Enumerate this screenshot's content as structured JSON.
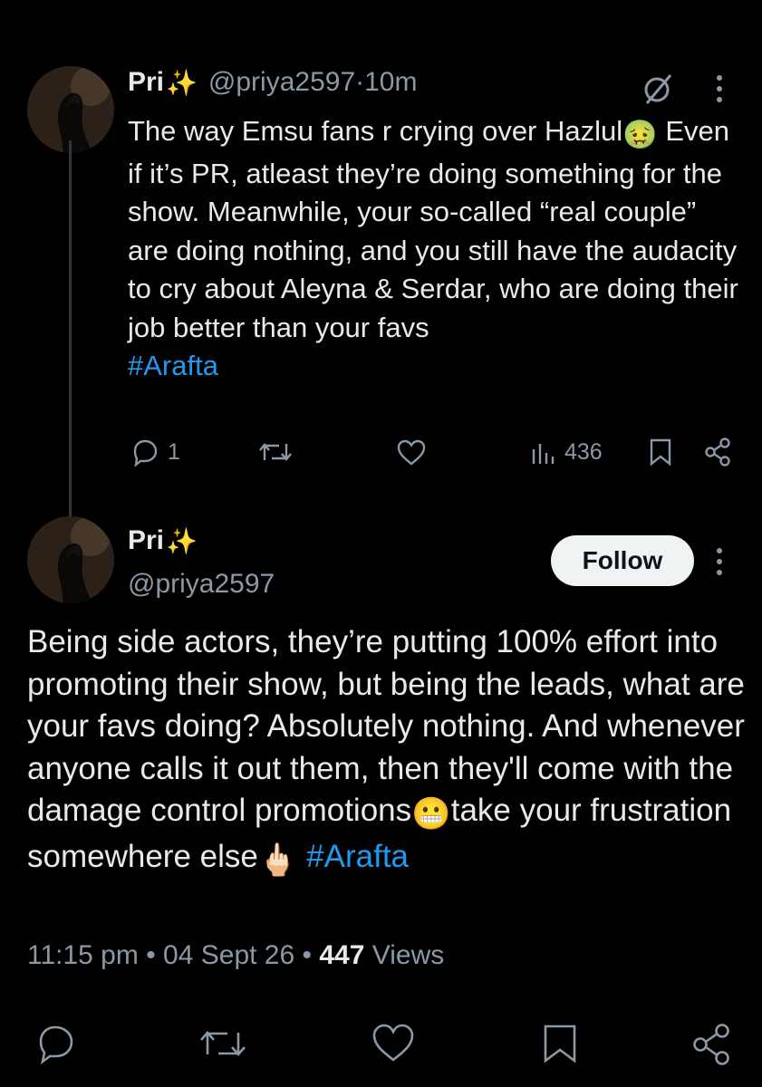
{
  "tweet1": {
    "name": "Pri",
    "name_emoji": "✨",
    "handle": "@priya2597",
    "separator": " · ",
    "time": "10m",
    "text_line1": "The way Emsu fans r crying over Hazlul",
    "emoji1": "🤢",
    "text_rest": "Even if it’s PR, atleast they’re doing something for the show. Meanwhile, your so-called “real couple” are doing nothing, and you still have the audacity to cry about Aleyna & Serdar, who are doing their job better than your favs",
    "hashtag": "#Arafta",
    "replies": "1",
    "views": "436"
  },
  "tweet2": {
    "name": "Pri",
    "name_emoji": "✨",
    "handle": "@priya2597",
    "follow_label": "Follow",
    "text_part1": "Being side actors, they’re putting 100% effort into promoting their show, but being the leads, what are your favs doing? Absolutely nothing. And whenever anyone calls it out them, then they'll come with the damage control promotions",
    "emoji1": "😬",
    "text_part2": "take your frustration somewhere else",
    "emoji2": "🖕🏻",
    "hashtag": "#Arafta",
    "meta_time": "11:15 pm",
    "meta_dot": " • ",
    "meta_date": "04 Sept 26",
    "meta_views_count": "447",
    "meta_views_label": " Views"
  }
}
